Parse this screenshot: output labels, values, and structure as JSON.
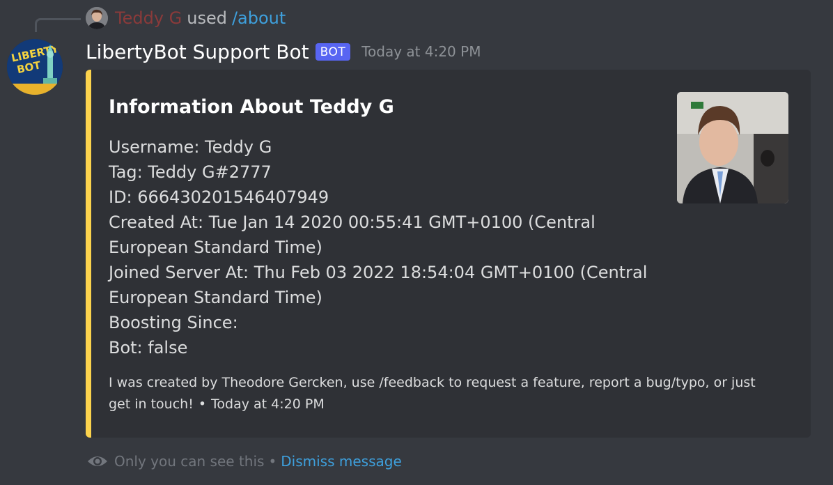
{
  "reply": {
    "username": "Teddy G",
    "used_text": "used",
    "command": "/about",
    "avatar_icon": "user-photo-avatar"
  },
  "message": {
    "author": "LibertyBot Support Bot",
    "tag": "BOT",
    "timestamp": "Today at 4:20 PM",
    "avatar_icon": "libertybot-logo-avatar",
    "avatar_logo_text": "LIBERTY BOT"
  },
  "embed": {
    "accent_color": "#fcd34d",
    "title": "Information About Teddy G",
    "thumbnail_icon": "user-profile-photo",
    "fields": [
      "Username: Teddy G",
      "Tag: Teddy G#2777",
      "ID: 666430201546407949",
      "Created At: Tue Jan 14 2020 00:55:41 GMT+0100 (Central",
      "European Standard Time)",
      "Joined Server At: Thu Feb 03 2022 18:54:04 GMT+0100 (Central",
      "European Standard Time)",
      "Boosting Since:",
      "Bot: false"
    ],
    "footer_text": "I was created by Theodore Gercken, use /feedback to request a feature, report a bug/typo, or just get in touch!",
    "footer_separator": "•",
    "footer_timestamp": "Today at 4:20 PM"
  },
  "ephemeral": {
    "icon": "eye-icon",
    "text": "Only you can see this",
    "separator": "•",
    "dismiss_label": "Dismiss message"
  },
  "colors": {
    "background": "#36393f",
    "embed_background": "#2f3136",
    "bot_tag": "#5865f2",
    "link": "#3ea0dd"
  }
}
